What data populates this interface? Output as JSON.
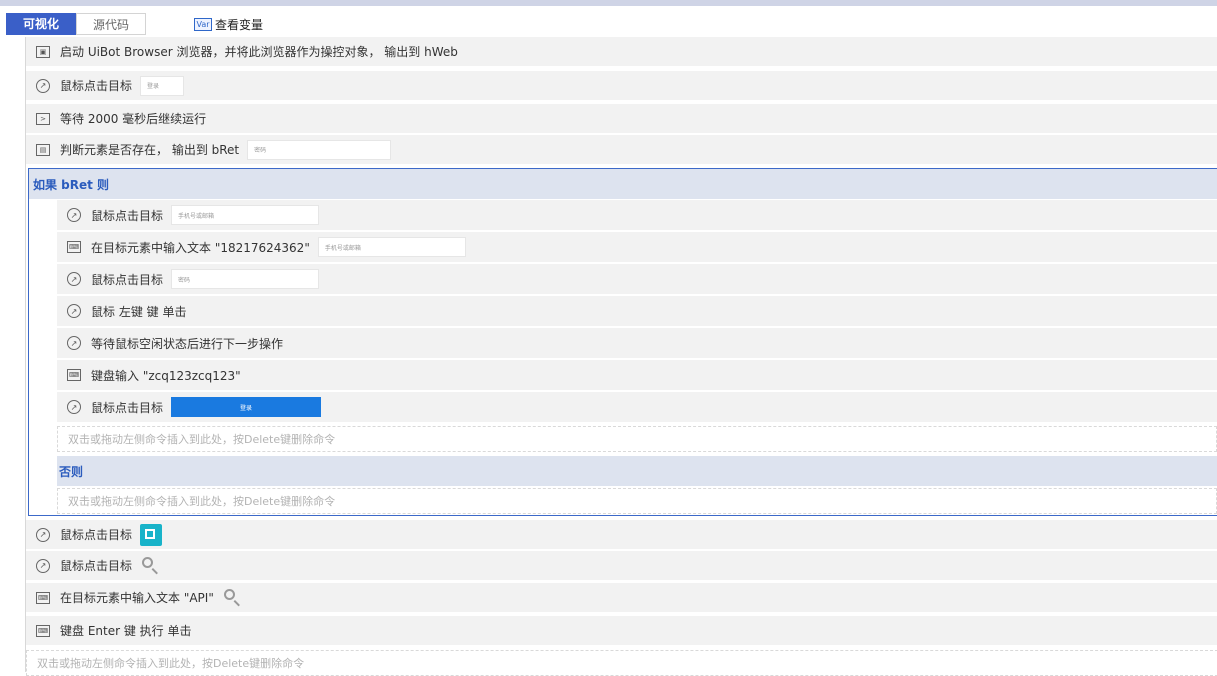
{
  "tabs": {
    "visual": "可视化",
    "source": "源代码",
    "variables": "查看变量",
    "variables_icon": "Var"
  },
  "steps": [
    {
      "icon": "browser-icon",
      "label": "启动 UiBot Browser 浏览器，并将此浏览器作为操控对象， 输出到 hWeb"
    },
    {
      "icon": "mouse-icon",
      "label": "鼠标点击目标",
      "thumb": "登录"
    },
    {
      "icon": "terminal-icon",
      "label": "等待 2000 毫秒后继续运行"
    },
    {
      "icon": "window-icon",
      "label": "判断元素是否存在， 输出到 bRet",
      "thumb": "密码"
    }
  ],
  "if_block": {
    "header": "如果 bRet 则",
    "steps": [
      {
        "icon": "mouse-icon",
        "label": "鼠标点击目标",
        "thumb": "手机号或邮箱"
      },
      {
        "icon": "keyboard-icon",
        "label": "在目标元素中输入文本 \"18217624362\"",
        "thumb": "手机号或邮箱"
      },
      {
        "icon": "mouse-icon",
        "label": "鼠标点击目标",
        "thumb": "密码"
      },
      {
        "icon": "mouse-icon",
        "label": "鼠标 左键 键 单击"
      },
      {
        "icon": "mouse-icon",
        "label": "等待鼠标空闲状态后进行下一步操作"
      },
      {
        "icon": "keyboard-icon",
        "label": "键盘输入 \"zcq123zcq123\""
      },
      {
        "icon": "mouse-icon",
        "label": "鼠标点击目标",
        "thumb": "登录"
      }
    ],
    "hint": "双击或拖动左侧命令插入到此处，按Delete键删除命令",
    "else_header": "否则",
    "else_hint": "双击或拖动左侧命令插入到此处，按Delete键删除命令"
  },
  "after_steps": [
    {
      "icon": "mouse-icon",
      "label": "鼠标点击目标",
      "target": "edit-image"
    },
    {
      "icon": "mouse-icon",
      "label": "鼠标点击目标",
      "target": "search-image"
    },
    {
      "icon": "keyboard-icon",
      "label": "在目标元素中输入文本 \"API\"",
      "target": "search-image"
    },
    {
      "icon": "keyboard-icon",
      "label": "键盘 Enter 键 执行 单击"
    }
  ],
  "footer_hint": "双击或拖动左侧命令插入到此处，按Delete键删除命令",
  "colors": {
    "accent": "#3a5fc8",
    "block_border": "#3c69c9",
    "row_bg": "#f2f2f2",
    "header_bg": "#dde3ef",
    "button_blue": "#1a7ae0"
  }
}
